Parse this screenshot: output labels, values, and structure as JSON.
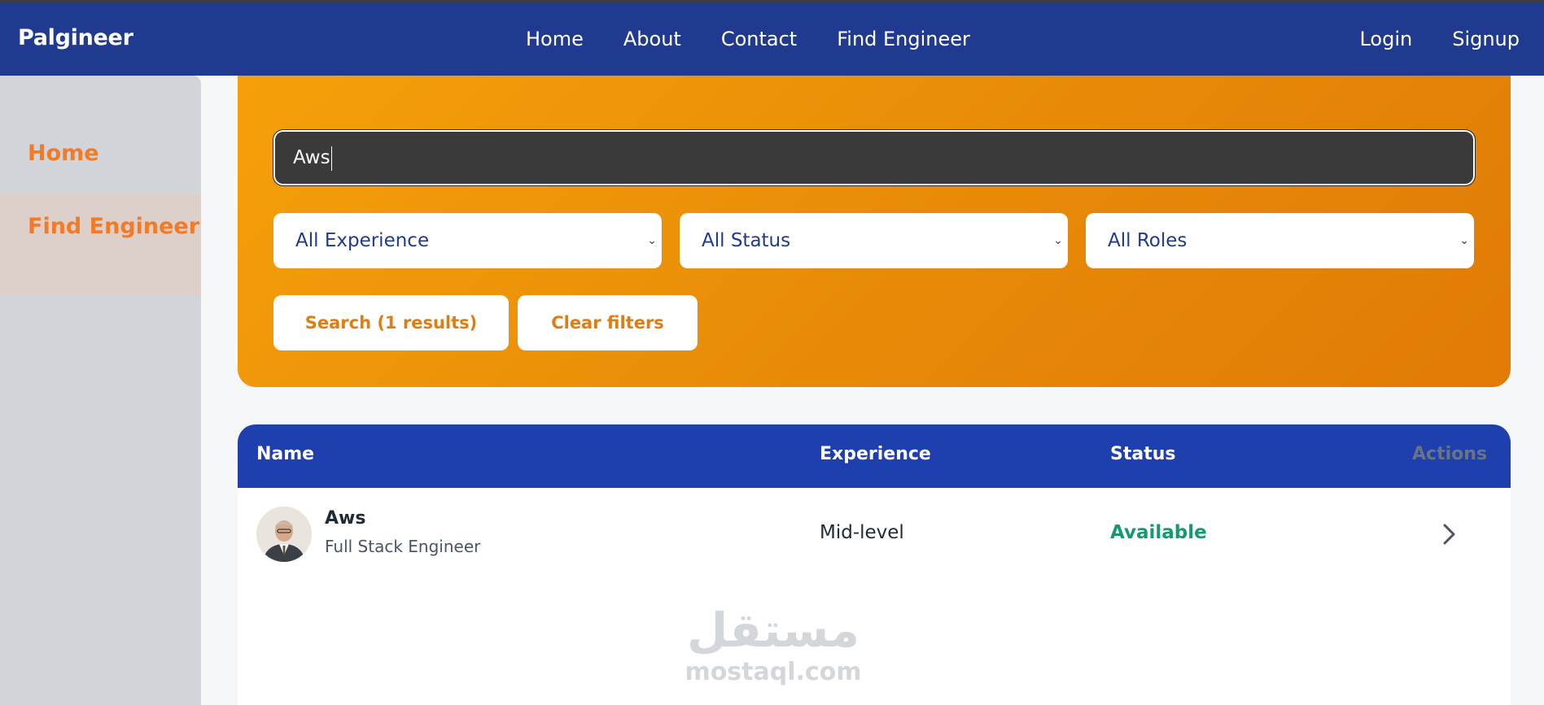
{
  "header": {
    "brand": "Palgineer",
    "nav": [
      "Home",
      "About",
      "Contact",
      "Find Engineer"
    ],
    "auth": {
      "login": "Login",
      "signup": "Signup"
    }
  },
  "sidebar": {
    "items": [
      {
        "label": "Home",
        "active": false
      },
      {
        "label": "Find Engineer",
        "active": true
      }
    ]
  },
  "filters": {
    "search_value": "Aws",
    "experience": "All Experience",
    "status": "All Status",
    "roles": "All Roles",
    "search_button": "Search (1 results)",
    "clear_button": "Clear filters"
  },
  "table": {
    "headers": {
      "name": "Name",
      "experience": "Experience",
      "status": "Status",
      "actions": "Actions"
    },
    "rows": [
      {
        "name": "Aws",
        "role": "Full Stack Engineer",
        "experience": "Mid-level",
        "status": "Available"
      }
    ]
  },
  "watermark": {
    "logo": "مستقل",
    "url": "mostaql.com"
  },
  "colors": {
    "navbar": "#1f3a8f",
    "accent_orange": "#f39c0c",
    "table_header": "#1e40af",
    "status_available": "#159a6b",
    "sidebar_text": "#f47a26"
  }
}
